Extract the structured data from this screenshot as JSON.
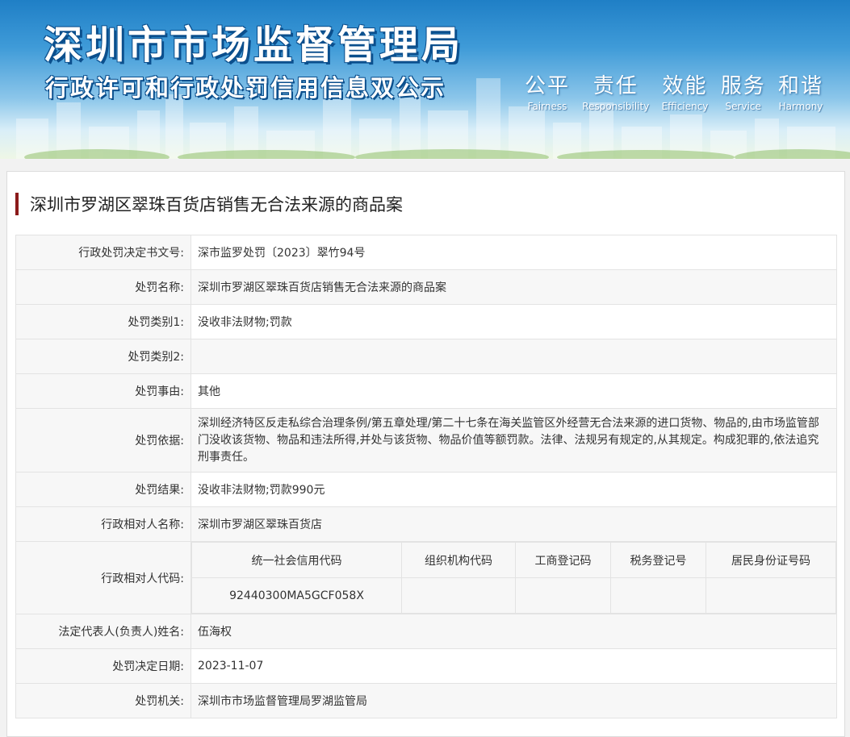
{
  "banner": {
    "title": "深圳市市场监督管理局",
    "subtitle": "行政许可和行政处罚信用信息双公示",
    "values": [
      {
        "cn": "公平",
        "en": "Fairness"
      },
      {
        "cn": "责任",
        "en": "Responsibility"
      },
      {
        "cn": "效能",
        "en": "Efficiency"
      },
      {
        "cn": "服务",
        "en": "Service"
      },
      {
        "cn": "和谐",
        "en": "Harmony"
      }
    ]
  },
  "case_title": "深圳市罗湖区翠珠百货店销售无合法来源的商品案",
  "fields": {
    "doc_no": {
      "label": "行政处罚决定书文号:",
      "value": "深市监罗处罚〔2023〕翠竹94号"
    },
    "name": {
      "label": "处罚名称:",
      "value": "深圳市罗湖区翠珠百货店销售无合法来源的商品案"
    },
    "cat1": {
      "label": "处罚类别1:",
      "value": "没收非法财物;罚款"
    },
    "cat2": {
      "label": "处罚类别2:",
      "value": ""
    },
    "reason": {
      "label": "处罚事由:",
      "value": "其他"
    },
    "basis": {
      "label": "处罚依据:",
      "value": "深圳经济特区反走私综合治理条例/第五章处理/第二十七条在海关监管区外经营无合法来源的进口货物、物品的,由市场监管部门没收该货物、物品和违法所得,并处与该货物、物品价值等额罚款。法律、法规另有规定的,从其规定。构成犯罪的,依法追究刑事责任。"
    },
    "result": {
      "label": "处罚结果:",
      "value": "没收非法财物;罚款990元"
    },
    "party": {
      "label": "行政相对人名称:",
      "value": "深圳市罗湖区翠珠百货店"
    },
    "codes": {
      "label": "行政相对人代码:",
      "headers": [
        "统一社会信用代码",
        "组织机构代码",
        "工商登记码",
        "税务登记号",
        "居民身份证号码"
      ],
      "values": [
        "92440300MA5GCF058X",
        "",
        "",
        "",
        ""
      ]
    },
    "rep": {
      "label": "法定代表人(负责人)姓名:",
      "value": "伍海权"
    },
    "date": {
      "label": "处罚决定日期:",
      "value": "2023-11-07"
    },
    "authority": {
      "label": "处罚机关:",
      "value": "深圳市市场监督管理局罗湖监管局"
    }
  },
  "colors": {
    "banner_top": "#1f7fc6",
    "title_outline": "#0b4f8d",
    "accent_bar": "#8b1a1a",
    "label_bg": "#f7f7f7"
  }
}
